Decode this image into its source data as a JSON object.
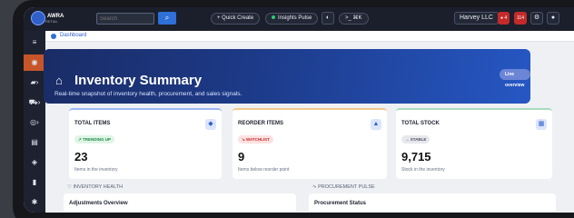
{
  "topbar": {
    "logo_text": "AWRA",
    "logo_sub": "RETAIL",
    "search_placeholder": "Search",
    "search_button_icon": "search-icon",
    "quick_create": "+ Quick Create",
    "insights_pulse": "Insights Pulse",
    "command_label": ">_ ⌘K",
    "company": "Harvey LLC",
    "notif_count_1": "4",
    "notif_count_2": "114"
  },
  "sidebar": {
    "items": [
      "menu-icon",
      "dashboard-icon",
      "briefcase-icon",
      "cart-icon",
      "users-icon",
      "orders-icon",
      "box-icon",
      "document-icon",
      "settings-icon"
    ]
  },
  "breadcrumb": {
    "label": "Dashboard"
  },
  "hero": {
    "title": "Inventory Summary",
    "subtitle": "Real-time snapshot of inventory health, procurement, and sales signals.",
    "live_button": "Live overview"
  },
  "cards": [
    {
      "title": "TOTAL ITEMS",
      "badge": "↗ TRENDING UP",
      "badge_bg": "#dff5e6",
      "badge_fg": "#1f8a47",
      "value": "23",
      "desc": "Items in the inventory",
      "accent": "#9db8f5",
      "icon_bg": "#dbe5fb",
      "icon_fg": "#2f5fc9"
    },
    {
      "title": "REORDER ITEMS",
      "badge": "↘ WATCHLIST",
      "badge_bg": "#fde1e1",
      "badge_fg": "#c42a2a",
      "value": "9",
      "desc": "Items below reorder point",
      "accent": "#f1c88a",
      "icon_bg": "#dbe5fb",
      "icon_fg": "#2f5fc9"
    },
    {
      "title": "TOTAL STOCK",
      "badge": "→ STABLE",
      "badge_bg": "#e6e8ec",
      "badge_fg": "#4b5263",
      "value": "9,715",
      "desc": "Stock in the inventory",
      "accent": "#a9dcc0",
      "icon_bg": "#dbe5fb",
      "icon_fg": "#2f5fc9"
    }
  ],
  "sections": {
    "left_head": "♡ INVENTORY HEALTH",
    "right_head": "∿ PROCUREMENT PULSE",
    "left_panel": "Adjustments Overview",
    "right_panel": "Procurement Status"
  }
}
